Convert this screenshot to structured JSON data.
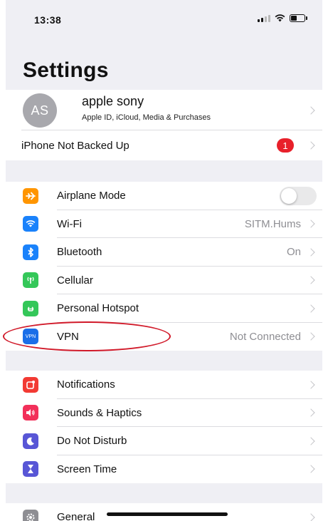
{
  "status_bar": {
    "time": "13:38"
  },
  "title": "Settings",
  "profile": {
    "initials": "AS",
    "name": "apple sony",
    "subtitle": "Apple ID, iCloud, Media & Purchases"
  },
  "backup": {
    "label": "iPhone Not Backed Up",
    "badge": "1"
  },
  "connectivity": [
    {
      "label": "Airplane Mode",
      "icon": "airplane-icon",
      "color": "#ff9500",
      "value": "",
      "toggle": false
    },
    {
      "label": "Wi-Fi",
      "icon": "wifi-icon",
      "color": "#1a82fb",
      "value": "SITM.Hums"
    },
    {
      "label": "Bluetooth",
      "icon": "bluetooth-icon",
      "color": "#1a82fb",
      "value": "On"
    },
    {
      "label": "Cellular",
      "icon": "cellular-icon",
      "color": "#34c759",
      "value": ""
    },
    {
      "label": "Personal Hotspot",
      "icon": "hotspot-icon",
      "color": "#34c759",
      "value": ""
    },
    {
      "label": "VPN",
      "icon": "vpn-icon",
      "icon_text": "VPN",
      "color": "#1a6ee8",
      "value": "Not Connected"
    }
  ],
  "notifications_group": [
    {
      "label": "Notifications",
      "icon": "notifications-icon",
      "color": "#f23a33"
    },
    {
      "label": "Sounds & Haptics",
      "icon": "sounds-icon",
      "color": "#f2305a"
    },
    {
      "label": "Do Not Disturb",
      "icon": "moon-icon",
      "color": "#5856d6"
    },
    {
      "label": "Screen Time",
      "icon": "hourglass-icon",
      "color": "#5856d6"
    }
  ],
  "general": {
    "label": "General",
    "icon": "gear-icon",
    "color": "#8e8e93"
  },
  "colors": {
    "background": "#efeff4",
    "highlight_circle": "#d11a2a",
    "badge": "#e8202a"
  }
}
